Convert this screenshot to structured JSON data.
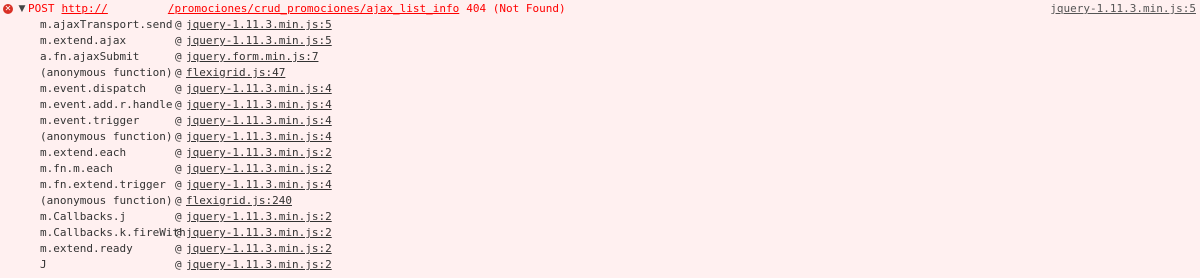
{
  "error": {
    "icon": "error-circle-x-icon",
    "toggle_icon": "triangle-down-icon",
    "method": "POST",
    "url_prefix": "http://",
    "url_path": "/promociones/crud_promociones/ajax_list_info",
    "status": "404 (Not Found)",
    "source": "jquery-1.11.3.min.js:5"
  },
  "stack": [
    {
      "fn": "m.ajaxTransport.send",
      "at": "@",
      "loc": "jquery-1.11.3.min.js:5"
    },
    {
      "fn": "m.extend.ajax",
      "at": "@",
      "loc": "jquery-1.11.3.min.js:5"
    },
    {
      "fn": "a.fn.ajaxSubmit",
      "at": "@",
      "loc": "jquery.form.min.js:7"
    },
    {
      "fn": "(anonymous function)",
      "at": "@",
      "loc": "flexigrid.js:47"
    },
    {
      "fn": "m.event.dispatch",
      "at": "@",
      "loc": "jquery-1.11.3.min.js:4"
    },
    {
      "fn": "m.event.add.r.handle",
      "at": "@",
      "loc": "jquery-1.11.3.min.js:4"
    },
    {
      "fn": "m.event.trigger",
      "at": "@",
      "loc": "jquery-1.11.3.min.js:4"
    },
    {
      "fn": "(anonymous function)",
      "at": "@",
      "loc": "jquery-1.11.3.min.js:4"
    },
    {
      "fn": "m.extend.each",
      "at": "@",
      "loc": "jquery-1.11.3.min.js:2"
    },
    {
      "fn": "m.fn.m.each",
      "at": "@",
      "loc": "jquery-1.11.3.min.js:2"
    },
    {
      "fn": "m.fn.extend.trigger",
      "at": "@",
      "loc": "jquery-1.11.3.min.js:4"
    },
    {
      "fn": "(anonymous function)",
      "at": "@",
      "loc": "flexigrid.js:240"
    },
    {
      "fn": "m.Callbacks.j",
      "at": "@",
      "loc": "jquery-1.11.3.min.js:2"
    },
    {
      "fn": "m.Callbacks.k.fireWith",
      "at": "@",
      "loc": "jquery-1.11.3.min.js:2"
    },
    {
      "fn": "m.extend.ready",
      "at": "@",
      "loc": "jquery-1.11.3.min.js:2"
    },
    {
      "fn": "J",
      "at": "@",
      "loc": "jquery-1.11.3.min.js:2"
    }
  ],
  "colors": {
    "background": "#fff0f0",
    "error_text": "#ff0000",
    "error_icon": "#d93025",
    "stack_text": "#333333"
  }
}
